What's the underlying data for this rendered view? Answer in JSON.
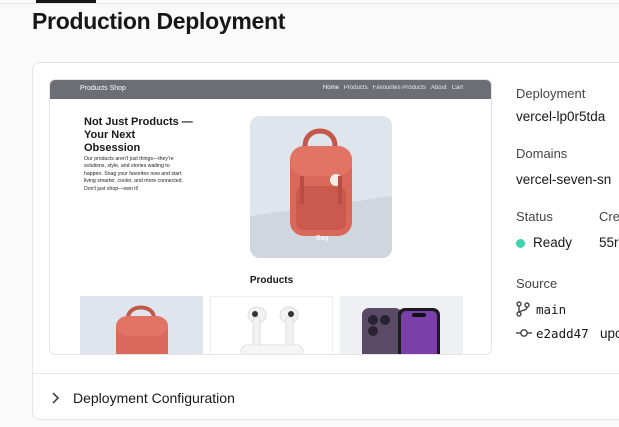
{
  "page": {
    "title": "Production Deployment"
  },
  "preview": {
    "nav": {
      "brand": "Products Shop",
      "links": [
        "Home",
        "Products",
        "Favourites Products",
        "About",
        "Cart"
      ]
    },
    "hero": {
      "title": "Not Just Products — Your Next Obsession",
      "text": "Our products aren't just things—they're solutions, style, and stories waiting to happen. Snag your favorites now and start living smarter, cooler, and more connected. Don't just shop—own it!",
      "image_caption": "Bag"
    },
    "products_title": "Products"
  },
  "info": {
    "deployment_label": "Deployment",
    "deployment_value": "vercel-lp0r5tda",
    "domains_label": "Domains",
    "domains_value": "vercel-seven-sn",
    "status_label": "Status",
    "status_value": "Ready",
    "status_color": "#3dd5b0",
    "created_label": "Cre",
    "created_value": "55r",
    "source_label": "Source",
    "branch": "main",
    "commit": "e2add47",
    "commit_message": "upc"
  },
  "config": {
    "label": "Deployment Configuration"
  }
}
